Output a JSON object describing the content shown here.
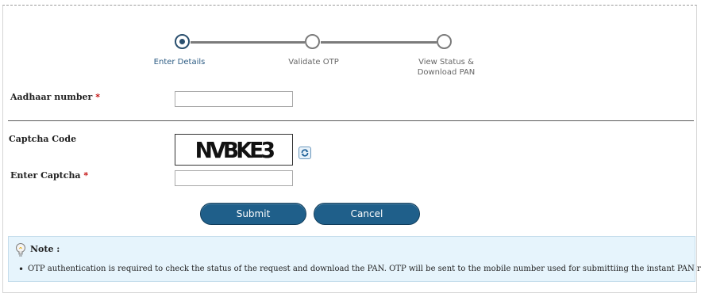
{
  "stepper": {
    "steps": [
      {
        "label": "Enter Details",
        "active": true
      },
      {
        "label": "Validate OTP",
        "active": false
      },
      {
        "label": "View Status &",
        "label2": "Download PAN",
        "active": false
      }
    ]
  },
  "form": {
    "aadhaar_label": "Aadhaar number",
    "aadhaar_value": "",
    "captcha_label": "Captcha Code",
    "captcha_text": "NVBKE3",
    "enter_captcha_label": "Enter Captcha",
    "enter_captcha_value": "",
    "required_mark": "*"
  },
  "buttons": {
    "submit_label": "Submit",
    "cancel_label": "Cancel"
  },
  "note": {
    "title": "Note :",
    "items": [
      "OTP authentication is required to check the status of the request and download the PAN. OTP will be sent to the mobile number used for submittiing the instant PAN request."
    ]
  },
  "colors": {
    "button_bg": "#1f5f8a",
    "note_bg": "#e6f4fc",
    "active_step": "#2a4f6e",
    "required": "#c00000"
  }
}
